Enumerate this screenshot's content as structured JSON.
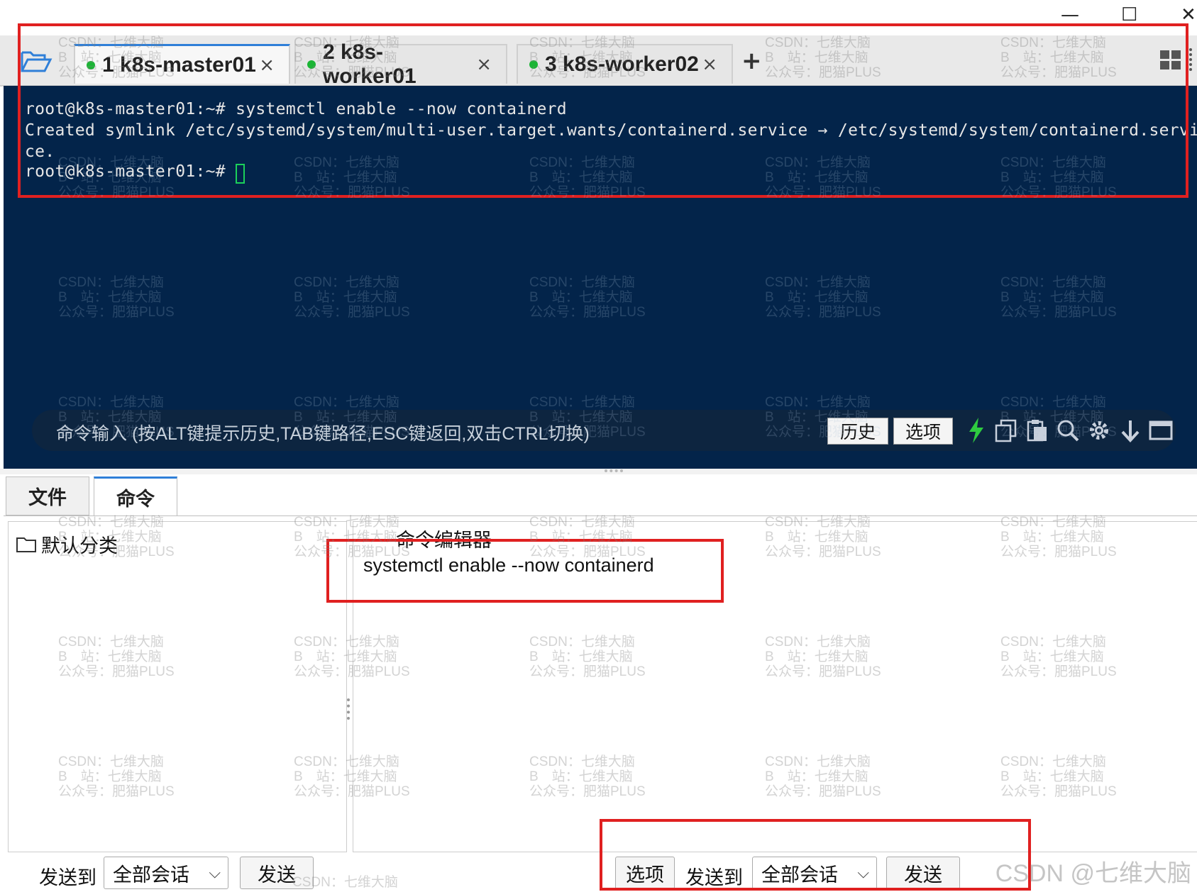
{
  "window": {
    "minimize_glyph": "—",
    "maximize_glyph": "☐",
    "close_glyph": "✕"
  },
  "tabs": [
    {
      "label": "1 k8s-master01",
      "status_color": "#1bb535",
      "close": "×",
      "active": true
    },
    {
      "label": "2 k8s-worker01",
      "status_color": "#1bb535",
      "close": "×",
      "active": false
    },
    {
      "label": "3 k8s-worker02",
      "status_color": "#1bb535",
      "close": "×",
      "active": false
    }
  ],
  "tabbar": {
    "add_glyph": "+",
    "folder_icon": "folder-open-icon",
    "grid_icon": "grid-icon"
  },
  "terminal": {
    "lines": [
      "root@k8s-master01:~# systemctl enable --now containerd",
      "Created symlink /etc/systemd/system/multi-user.target.wants/containerd.service → /etc/systemd/system/containerd.servi",
      "ce.",
      "root@k8s-master01:~# "
    ]
  },
  "cmdbar": {
    "hint": "命令输入 (按ALT键提示历史,TAB键路径,ESC键返回,双击CTRL切换)",
    "history": "历史",
    "options": "选项"
  },
  "bottom_tabs": [
    "文件",
    "命令"
  ],
  "left_panel": {
    "category": "默认分类"
  },
  "editor": {
    "title": "命令编辑器",
    "content": "systemctl enable --now containerd"
  },
  "footer_left": {
    "send_to": "发送到",
    "target": "全部会话",
    "send": "发送"
  },
  "footer_right": {
    "options": "选项",
    "send_to": "发送到",
    "target": "全部会话",
    "send": "发送"
  },
  "watermark": {
    "text": "CSDN：七维大脑\nB　站：七维大脑\n公众号：肥猫PLUS",
    "corner": "CSDN @七维大脑",
    "tail": "CSDN：七维大脑"
  },
  "colors": {
    "terminal_bg": "#03244a",
    "accent": "#2f7fd8",
    "highlight": "#e02020",
    "status_green": "#1bb535"
  }
}
